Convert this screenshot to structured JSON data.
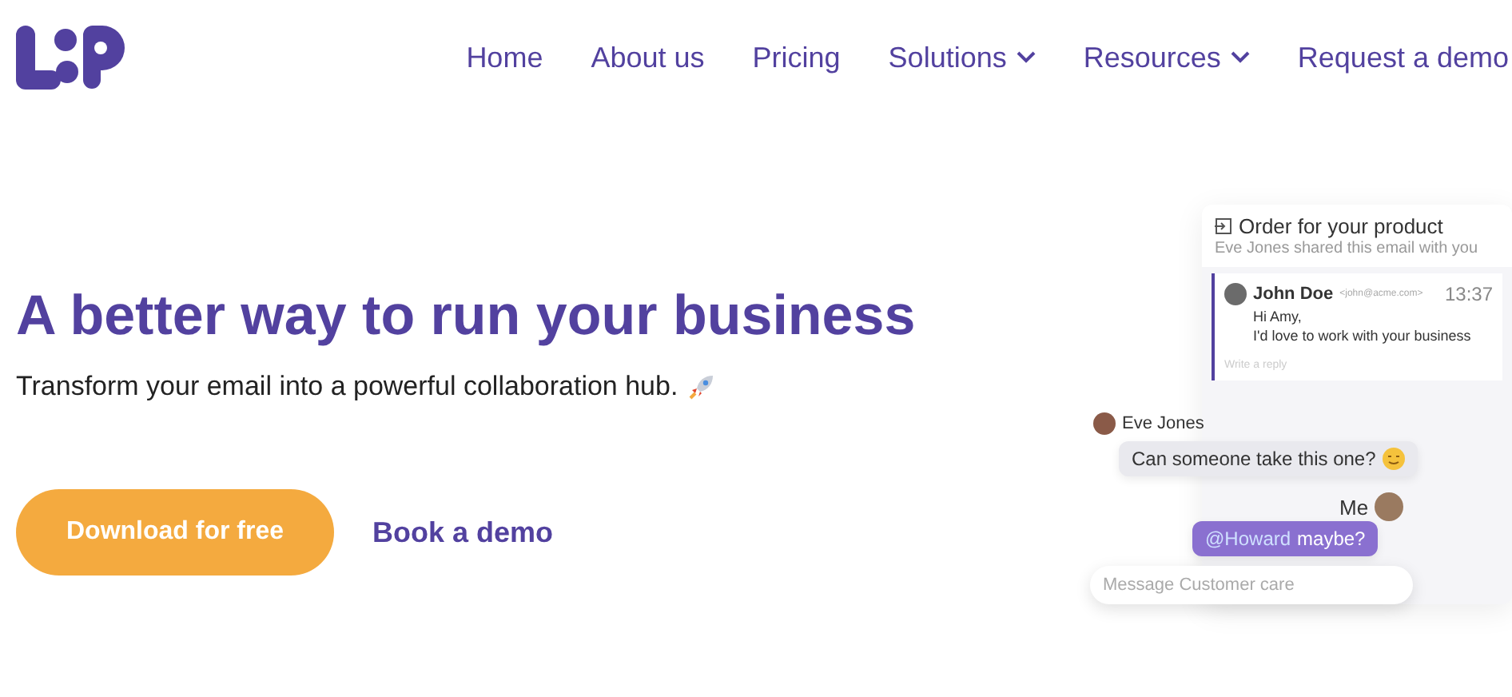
{
  "nav": {
    "items": [
      {
        "label": "Home",
        "dropdown": false
      },
      {
        "label": "About us",
        "dropdown": false
      },
      {
        "label": "Pricing",
        "dropdown": false
      },
      {
        "label": "Solutions",
        "dropdown": true
      },
      {
        "label": "Resources",
        "dropdown": true
      },
      {
        "label": "Request a demo",
        "dropdown": false
      }
    ]
  },
  "hero": {
    "title": "A better way to run your business",
    "subtitle": "Transform your email into a powerful collaboration hub.",
    "primary_button": "Download for free",
    "secondary_link": "Book a demo"
  },
  "preview": {
    "subject": "Order for your product",
    "shared_note": "Eve Jones shared this email with you",
    "email": {
      "sender": "John Doe",
      "address": "<john@acme.com>",
      "time": "13:37",
      "body": [
        "Hi Amy,",
        "I'd love to work with your business"
      ],
      "reply_placeholder": "Write a reply"
    },
    "chat": [
      {
        "author": "Eve Jones",
        "text": "Can someone take this one?",
        "mine": false
      },
      {
        "author": "Me",
        "mention": "@Howard",
        "text": "maybe?",
        "mine": true
      }
    ],
    "message_placeholder": "Message Customer care"
  }
}
